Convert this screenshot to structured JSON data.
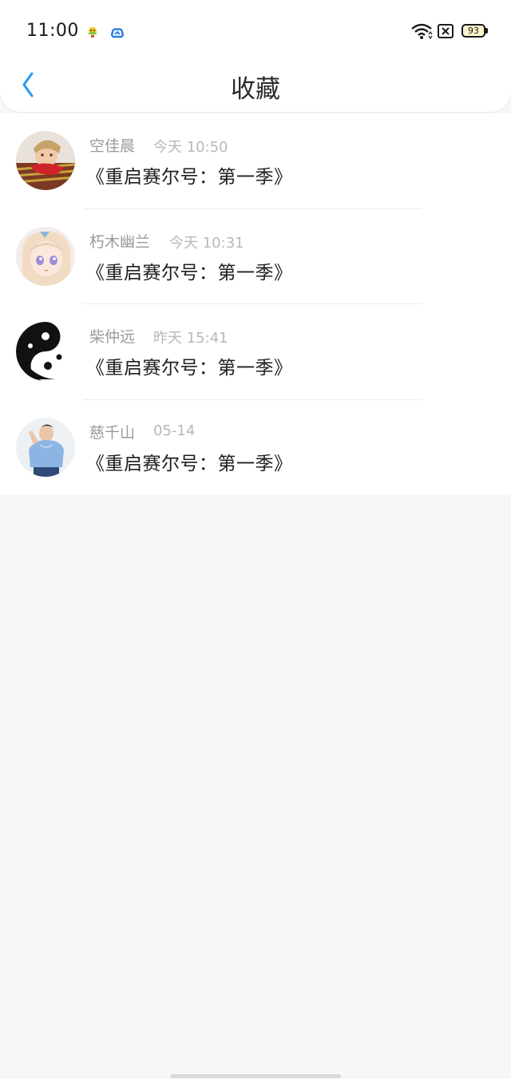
{
  "status_bar": {
    "time": "11:00",
    "battery_level": "93",
    "notification_icons": [
      "weather-icon",
      "cloud-sync-icon"
    ],
    "system_icons": [
      "wifi-icon",
      "sim-off-icon",
      "battery-icon"
    ]
  },
  "nav": {
    "title": "收藏",
    "back_icon": "chevron-left-icon",
    "accent_color": "#2b9af3"
  },
  "favorites": [
    {
      "name": "空佳晨",
      "time": "今天 10:50",
      "title": "《重启赛尔号：第一季》",
      "avatar": "avatar-woman-red-scarf"
    },
    {
      "name": "朽木幽兰",
      "time": "今天 10:31",
      "title": "《重启赛尔号：第一季》",
      "avatar": "avatar-anime-girl"
    },
    {
      "name": "柴仲远",
      "time": "昨天 15:41",
      "title": "《重启赛尔号：第一季》",
      "avatar": "avatar-yin-yang"
    },
    {
      "name": "慈千山",
      "time": "05-14",
      "title": "《重启赛尔号：第一季》",
      "avatar": "avatar-woman-blue-shirt"
    }
  ],
  "colors": {
    "background": "#f8f6f7",
    "card": "#ffffff",
    "name_text": "#9a9a9a",
    "time_text": "#b8b8b8",
    "title_text": "#1f1f1f"
  }
}
